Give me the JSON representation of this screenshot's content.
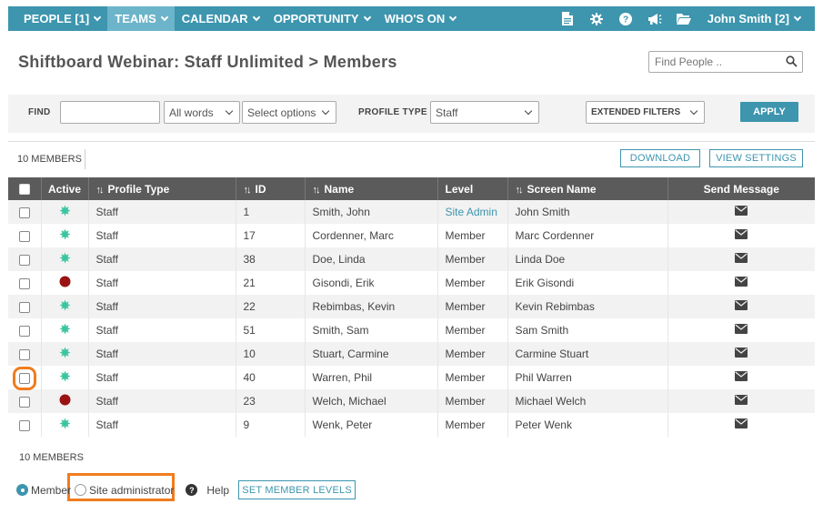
{
  "nav": {
    "items": [
      {
        "label": "PEOPLE [1]",
        "active": false
      },
      {
        "label": "TEAMS",
        "active": true
      },
      {
        "label": "CALENDAR",
        "active": false
      },
      {
        "label": "OPPORTUNITY",
        "active": false
      },
      {
        "label": "WHO'S ON",
        "active": false
      }
    ],
    "icons": [
      "document-icon",
      "gear-icon",
      "help-icon",
      "megaphone-icon",
      "folder-icon"
    ],
    "user_label": "John Smith [2]"
  },
  "header": {
    "title": "Shiftboard Webinar: Staff Unlimited > Members",
    "search_placeholder": "Find People .."
  },
  "filters": {
    "find_label": "FIND",
    "find_value": "",
    "match_select": "All words",
    "options_select": "Select options",
    "profile_type_label": "PROFILE TYPE",
    "profile_type_value": "Staff",
    "extended_filters_label": "EXTENDED FILTERS",
    "apply_label": "APPLY"
  },
  "toolbar": {
    "count_label": "10 MEMBERS",
    "download_label": "DOWNLOAD",
    "view_settings_label": "VIEW SETTINGS"
  },
  "table": {
    "headers": {
      "active": "Active",
      "profile_type": "Profile Type",
      "id": "ID",
      "name": "Name",
      "level": "Level",
      "screen_name": "Screen Name",
      "send_message": "Send Message"
    },
    "rows": [
      {
        "active": true,
        "profile_type": "Staff",
        "id": "1",
        "name": "Smith, John",
        "level": "Site Admin",
        "screen_name": "John Smith"
      },
      {
        "active": true,
        "profile_type": "Staff",
        "id": "17",
        "name": "Cordenner, Marc",
        "level": "Member",
        "screen_name": "Marc Cordenner"
      },
      {
        "active": true,
        "profile_type": "Staff",
        "id": "38",
        "name": "Doe, Linda",
        "level": "Member",
        "screen_name": "Linda Doe"
      },
      {
        "active": false,
        "profile_type": "Staff",
        "id": "21",
        "name": "Gisondi, Erik",
        "level": "Member",
        "screen_name": "Erik Gisondi"
      },
      {
        "active": true,
        "profile_type": "Staff",
        "id": "22",
        "name": "Rebimbas, Kevin",
        "level": "Member",
        "screen_name": "Kevin Rebimbas"
      },
      {
        "active": true,
        "profile_type": "Staff",
        "id": "51",
        "name": "Smith, Sam",
        "level": "Member",
        "screen_name": "Sam Smith"
      },
      {
        "active": true,
        "profile_type": "Staff",
        "id": "10",
        "name": "Stuart, Carmine",
        "level": "Member",
        "screen_name": "Carmine Stuart"
      },
      {
        "active": true,
        "profile_type": "Staff",
        "id": "40",
        "name": "Warren, Phil",
        "level": "Member",
        "screen_name": "Phil Warren",
        "highlighted": true
      },
      {
        "active": false,
        "profile_type": "Staff",
        "id": "23",
        "name": "Welch, Michael",
        "level": "Member",
        "screen_name": "Michael Welch"
      },
      {
        "active": true,
        "profile_type": "Staff",
        "id": "9",
        "name": "Wenk, Peter",
        "level": "Member",
        "screen_name": "Peter Wenk"
      }
    ]
  },
  "footer": {
    "count_label": "10 MEMBERS",
    "member_radio_label": "Member",
    "site_admin_radio_label": "Site administrator",
    "selected_level": "Member",
    "help_label": "Help",
    "set_levels_label": "SET MEMBER LEVELS"
  },
  "colors": {
    "brand": "#3d95ae",
    "nav_active": "#6cb4c9",
    "active_status": "#3cc4a0",
    "inactive_status": "#9b1212",
    "highlight": "#f07c1e"
  }
}
